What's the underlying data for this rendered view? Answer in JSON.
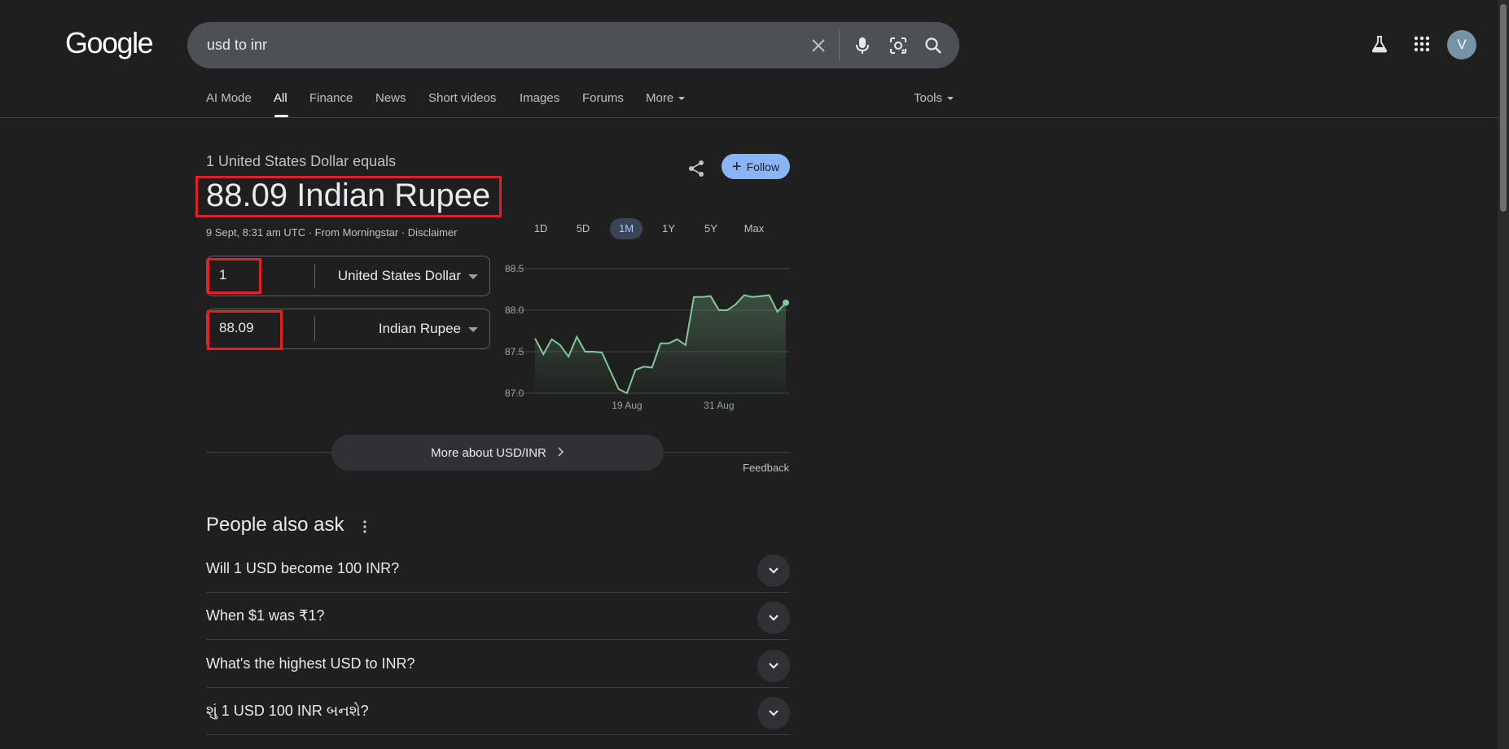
{
  "header": {
    "logo": "Google",
    "query": "usd to inr",
    "avatar_initial": "V"
  },
  "tabs": [
    {
      "label": "AI Mode"
    },
    {
      "label": "All"
    },
    {
      "label": "Finance"
    },
    {
      "label": "News"
    },
    {
      "label": "Short videos"
    },
    {
      "label": "Images"
    },
    {
      "label": "Forums"
    },
    {
      "label": "More"
    }
  ],
  "tools_label": "Tools",
  "finance": {
    "equals_text": "1 United States Dollar equals",
    "value_text": "88.09 Indian Rupee",
    "meta_text": "9 Sept, 8:31 am UTC · From Morningstar · Disclaimer",
    "follow_label": "Follow",
    "converter": {
      "from_amount": "1",
      "from_currency": "United States Dollar",
      "to_amount": "88.09",
      "to_currency": "Indian Rupee"
    },
    "ranges": [
      "1D",
      "5D",
      "1M",
      "1Y",
      "5Y",
      "Max"
    ],
    "active_range": "1M",
    "more_label": "More about USD/INR",
    "feedback_label": "Feedback"
  },
  "chart_data": {
    "type": "area",
    "ylim": [
      87.0,
      88.5
    ],
    "yticks": [
      "88.5",
      "88.0",
      "87.5",
      "87.0"
    ],
    "xtick_labels": [
      {
        "label": "19 Aug",
        "index": 11
      },
      {
        "label": "31 Aug",
        "index": 22
      }
    ],
    "values": [
      87.66,
      87.47,
      87.65,
      87.58,
      87.44,
      87.68,
      87.5,
      87.5,
      87.49,
      87.27,
      87.05,
      87.0,
      87.28,
      87.32,
      87.31,
      87.6,
      87.6,
      87.65,
      87.58,
      88.16,
      88.16,
      88.17,
      88.0,
      88.0,
      88.07,
      88.18,
      88.16,
      88.17,
      88.18,
      87.98,
      88.09
    ],
    "line_color": "#81c995"
  },
  "people_also_ask": {
    "title": "People also ask",
    "questions": [
      "Will 1 USD become 100 INR?",
      "When $1 was ₹1?",
      "What's the highest USD to INR?",
      "શું 1 USD 100 INR બનશે?"
    ]
  }
}
